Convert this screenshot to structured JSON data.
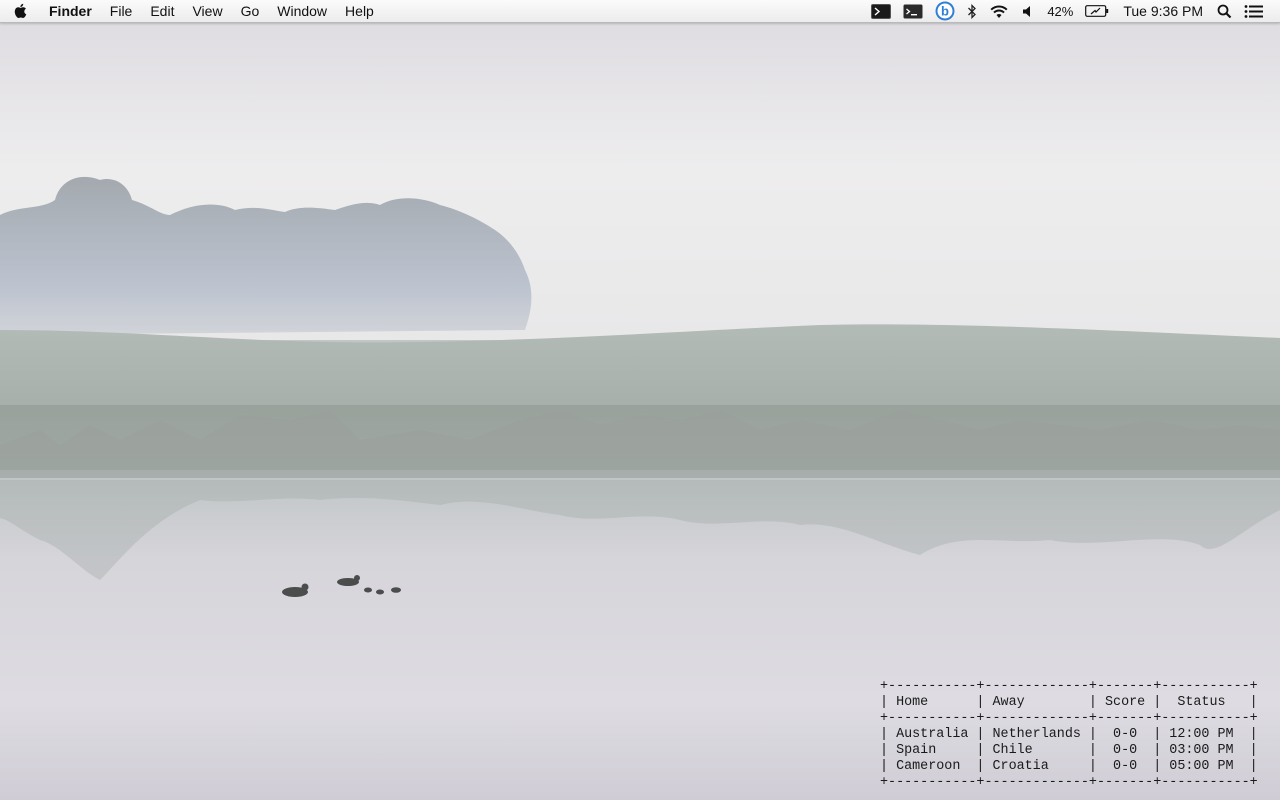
{
  "menubar": {
    "app_name": "Finder",
    "menus": [
      "File",
      "Edit",
      "View",
      "Go",
      "Window",
      "Help"
    ],
    "battery_percent": "42%",
    "clock": "Tue 9:36 PM",
    "status_icons": [
      "terminal-icon",
      "terminal-prompt-icon",
      "beats-icon",
      "bluetooth-icon",
      "wifi-icon",
      "volume-icon",
      "battery-charging-icon",
      "spotlight-search-icon",
      "notification-center-icon"
    ]
  },
  "scoreboard": {
    "columns": [
      "Home",
      "Away",
      "Score",
      "Status"
    ],
    "rows": [
      {
        "home": "Australia",
        "away": "Netherlands",
        "score": "0-0",
        "status": "12:00 PM"
      },
      {
        "home": "Spain",
        "away": "Chile",
        "score": "0-0",
        "status": "03:00 PM"
      },
      {
        "home": "Cameroon",
        "away": "Croatia",
        "score": "0-0",
        "status": "05:00 PM"
      }
    ]
  },
  "colors": {
    "menubar_bg": "#f2f2f2",
    "beats_blue": "#2f7fd6",
    "fog": "#eeeded",
    "water": "#d9d7de"
  }
}
